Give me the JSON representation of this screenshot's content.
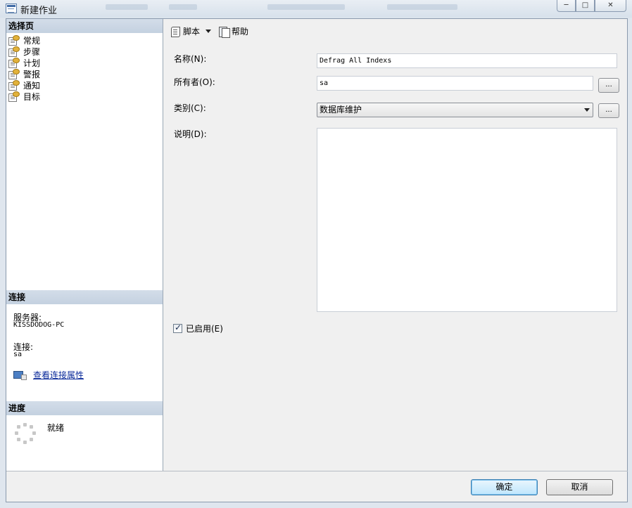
{
  "window": {
    "title": "新建作业",
    "controls": {
      "minimize": "─",
      "maximize": "□",
      "close": "✕"
    }
  },
  "left_pane": {
    "select_page_header": "选择页",
    "pages": [
      {
        "label": "常规",
        "icon": "page-settings-icon"
      },
      {
        "label": "步骤",
        "icon": "page-settings-icon"
      },
      {
        "label": "计划",
        "icon": "page-settings-icon"
      },
      {
        "label": "警报",
        "icon": "page-settings-icon"
      },
      {
        "label": "通知",
        "icon": "page-settings-icon"
      },
      {
        "label": "目标",
        "icon": "page-settings-icon"
      }
    ],
    "connection_header": "连接",
    "server_label": "服务器:",
    "server_value": "KISSDODOG-PC",
    "connection_label": "连接:",
    "connection_value": "sa",
    "view_connection_properties": "查看连接属性",
    "progress_header": "进度",
    "progress_status": "就绪"
  },
  "toolbar": {
    "script_label": "脚本",
    "help_label": "帮助"
  },
  "form": {
    "name_label": "名称(N):",
    "name_value": "Defrag All Indexs",
    "owner_label": "所有者(O):",
    "owner_value": "sa",
    "owner_browse": "...",
    "category_label": "类别(C):",
    "category_value": "数据库维护",
    "category_browse": "...",
    "description_label": "说明(D):",
    "description_value": "",
    "enabled_label": "已启用(E)",
    "enabled": true
  },
  "buttons": {
    "ok": "确定",
    "cancel": "取消"
  },
  "colors": {
    "section_header": "#c8d4e2",
    "link": "#0a2a9a",
    "default_button_border": "#3c7fb1"
  }
}
